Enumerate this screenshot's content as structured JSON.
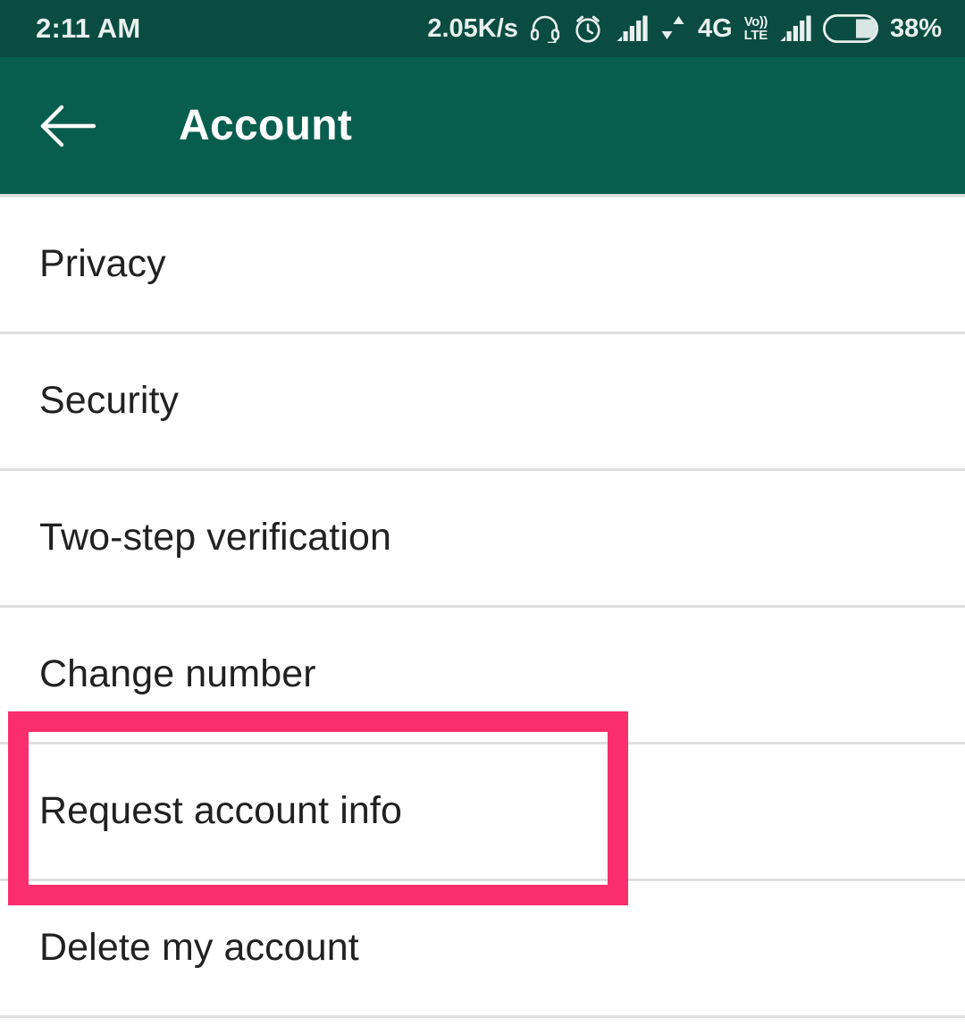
{
  "status_bar": {
    "clock": "2:11 AM",
    "network_speed": "2.05K/s",
    "network_type": "4G",
    "volte_top": "Vo))",
    "volte_bottom": "LTE",
    "battery_percent": "38%",
    "icons": [
      "headset-icon",
      "alarm-clock-icon",
      "signal-bars-icon",
      "data-transfer-icon",
      "volte-icon",
      "signal-bars-icon",
      "battery-icon"
    ],
    "background_color": "#0a4c41",
    "text_color": "#e8f0ee"
  },
  "toolbar": {
    "title": "Account",
    "back_icon": "arrow-left-icon",
    "background_color": "#075e4e",
    "title_color": "#ffffff"
  },
  "settings_list": {
    "items": [
      {
        "label": "Privacy"
      },
      {
        "label": "Security"
      },
      {
        "label": "Two-step verification"
      },
      {
        "label": "Change number"
      },
      {
        "label": "Request account info"
      },
      {
        "label": "Delete my account"
      }
    ],
    "divider_color": "#dfdfdf",
    "label_color": "#212121"
  },
  "highlight": {
    "target_label": "Request account info",
    "color": "#fa2e6e"
  }
}
